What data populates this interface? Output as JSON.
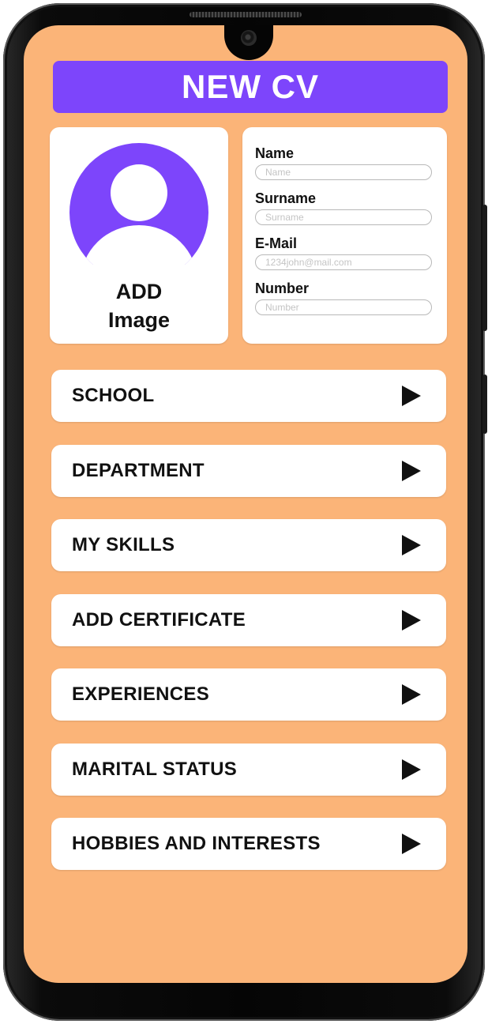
{
  "header": {
    "title": "NEW CV"
  },
  "profile_image": {
    "label_line1": "ADD",
    "label_line2": "Image"
  },
  "form": {
    "fields": [
      {
        "label": "Name",
        "placeholder": "Name"
      },
      {
        "label": "Surname",
        "placeholder": "Surname"
      },
      {
        "label": "E-Mail",
        "placeholder": "1234john@mail.com"
      },
      {
        "label": "Number",
        "placeholder": "Number"
      }
    ]
  },
  "menu": {
    "items": [
      {
        "label": "SCHOOL",
        "icon": "play-arrow-icon"
      },
      {
        "label": "DEPARTMENT",
        "icon": "play-arrow-icon"
      },
      {
        "label": "MY SKILLS",
        "icon": "play-arrow-icon"
      },
      {
        "label": "ADD CERTIFICATE",
        "icon": "play-arrow-icon"
      },
      {
        "label": "EXPERIENCES",
        "icon": "play-arrow-icon"
      },
      {
        "label": "MARITAL STATUS",
        "icon": "play-arrow-icon"
      },
      {
        "label": "HOBBIES AND INTERESTS",
        "icon": "play-arrow-icon"
      }
    ]
  },
  "colors": {
    "background": "#fbb478",
    "accent": "#7d45fb",
    "card": "#ffffff",
    "text": "#111111"
  }
}
